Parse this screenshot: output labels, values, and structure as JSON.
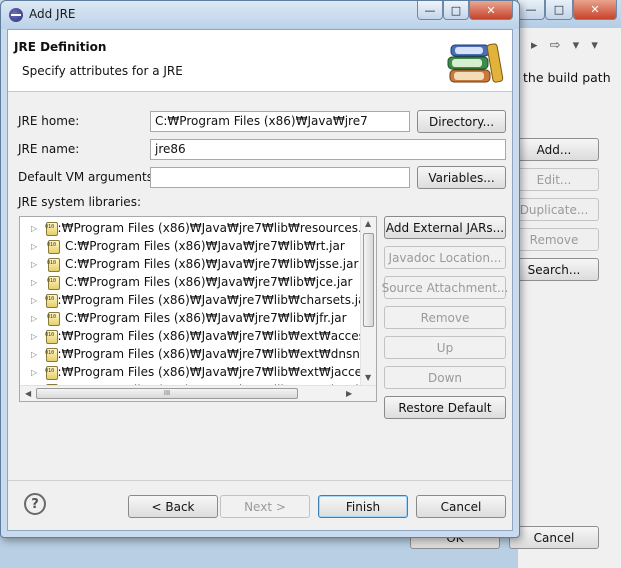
{
  "background": {
    "text": "the build path",
    "arrows": "▸ ⇨ ▾ ▾",
    "buttons": [
      "Add...",
      "Edit...",
      "Duplicate...",
      "Remove",
      "Search...",
      "Cancel",
      "OK"
    ],
    "win_controls": [
      "—",
      "□",
      "✕"
    ]
  },
  "dialog": {
    "title": "Add JRE",
    "win_controls": {
      "minimize": "—",
      "maximize": "□",
      "close": "✕"
    },
    "header_title": "JRE Definition",
    "header_subtitle": "Specify attributes for a JRE",
    "fields": {
      "jre_home_label": "JRE home:",
      "jre_home_value": "C:₩Program Files (x86)₩Java₩jre7",
      "jre_name_label": "JRE name:",
      "jre_name_value": "jre86",
      "vm_args_label": "Default VM arguments:",
      "vm_args_value": ""
    },
    "buttons": {
      "directory": "Directory...",
      "variables": "Variables...",
      "add_external_jars": "Add External JARs...",
      "javadoc_location": "Javadoc Location...",
      "source_attachment": "Source Attachment...",
      "remove": "Remove",
      "up": "Up",
      "down": "Down",
      "restore_default": "Restore Default",
      "back": "< Back",
      "next": "Next >",
      "finish": "Finish",
      "cancel": "Cancel"
    },
    "libraries_label": "JRE system libraries:",
    "libraries": [
      "C:₩Program Files (x86)₩Java₩jre7₩lib₩resources.jar",
      "C:₩Program Files (x86)₩Java₩jre7₩lib₩rt.jar",
      "C:₩Program Files (x86)₩Java₩jre7₩lib₩jsse.jar",
      "C:₩Program Files (x86)₩Java₩jre7₩lib₩jce.jar",
      "C:₩Program Files (x86)₩Java₩jre7₩lib₩charsets.jar",
      "C:₩Program Files (x86)₩Java₩jre7₩lib₩jfr.jar",
      "C:₩Program Files (x86)₩Java₩jre7₩lib₩ext₩access-bri",
      "C:₩Program Files (x86)₩Java₩jre7₩lib₩ext₩dnsns.jar",
      "C:₩Program Files (x86)₩Java₩jre7₩lib₩ext₩jaccess.jar",
      "C:₩Program Files (x86)₩Java₩jre7₩lib₩ext₩localedata"
    ],
    "help_icon": "?",
    "scroll_grip": "III"
  }
}
